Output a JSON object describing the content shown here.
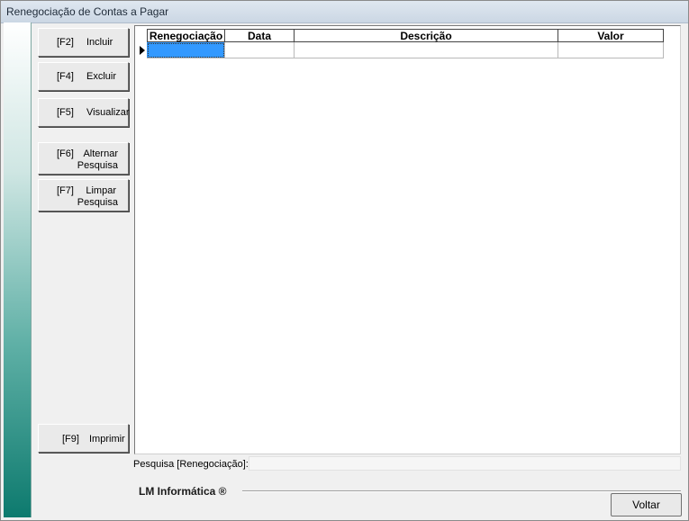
{
  "window": {
    "title": "Renegociação de Contas a Pagar"
  },
  "buttons": [
    {
      "key": "[F2]",
      "label": "Incluir"
    },
    {
      "key": "[F4]",
      "label": "Excluir"
    },
    {
      "key": "[F5]",
      "label": "Visualizar"
    },
    {
      "key": "[F6]",
      "label_line1": "Alternar",
      "label_line2": "Pesquisa"
    },
    {
      "key": "[F7]",
      "label_line1": "Limpar",
      "label_line2": "Pesquisa"
    },
    {
      "key": "[F9]",
      "label": "Imprimir"
    }
  ],
  "grid": {
    "columns": [
      "Renegociação",
      "Data",
      "Descrição",
      "Valor"
    ],
    "rows": [
      [
        "",
        "",
        "",
        ""
      ]
    ]
  },
  "search": {
    "label": "Pesquisa [Renegociação]:",
    "value": ""
  },
  "footer": {
    "brand": "LM Informática ®",
    "voltar_label": "Voltar"
  },
  "colors": {
    "selected_cell": "#3399ff",
    "sidebar_bottom": "#0d7a6e"
  }
}
